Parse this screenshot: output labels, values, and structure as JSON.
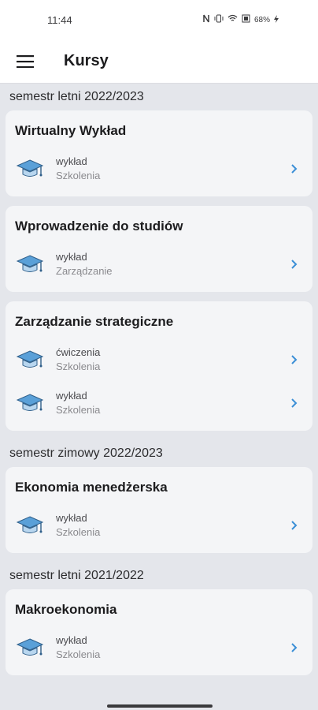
{
  "status": {
    "time": "11:44",
    "battery": "68%"
  },
  "app_bar": {
    "title": "Kursy"
  },
  "sections": [
    {
      "header": "semestr letni 2022/2023",
      "courses": [
        {
          "title": "Wirtualny Wykład",
          "rows": [
            {
              "type": "wykład",
              "unit": "Szkolenia"
            }
          ]
        },
        {
          "title": "Wprowadzenie do studiów",
          "rows": [
            {
              "type": "wykład",
              "unit": "Zarządzanie"
            }
          ]
        },
        {
          "title": "Zarządzanie strategiczne",
          "rows": [
            {
              "type": "ćwiczenia",
              "unit": "Szkolenia"
            },
            {
              "type": "wykład",
              "unit": "Szkolenia"
            }
          ]
        }
      ]
    },
    {
      "header": "semestr zimowy 2022/2023",
      "courses": [
        {
          "title": "Ekonomia menedżerska",
          "rows": [
            {
              "type": "wykład",
              "unit": "Szkolenia"
            }
          ]
        }
      ]
    },
    {
      "header": "semestr letni 2021/2022",
      "courses": [
        {
          "title": "Makroekonomia",
          "rows": [
            {
              "type": "wykład",
              "unit": "Szkolenia"
            }
          ]
        }
      ]
    }
  ],
  "icons": {
    "row_icon": "graduation-cap-icon",
    "row_action": "chevron-right-icon",
    "menu": "hamburger-menu-icon"
  },
  "colors": {
    "accent": "#3b8fd6",
    "cap": "#5aa0d8"
  }
}
